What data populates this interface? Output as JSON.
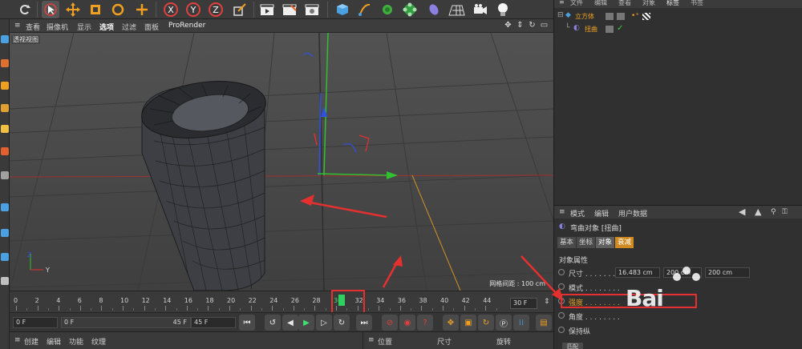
{
  "toolbar": {
    "icons": [
      "undo-icon",
      "select-icon",
      "move-icon",
      "scale-icon",
      "rotate-icon",
      "add-icon",
      "x-axis-icon",
      "y-axis-icon",
      "z-axis-icon",
      "world-coord-icon",
      "render-view-icon",
      "render-icon",
      "render-settings-icon",
      "cube-icon",
      "pen-icon",
      "nurbs-icon",
      "array-icon",
      "deformer-icon",
      "floor-icon",
      "camera-icon",
      "light-icon"
    ],
    "axis_x": "X",
    "axis_y": "Y",
    "axis_z": "Z"
  },
  "viewport": {
    "menus": [
      "查看",
      "摄像机",
      "显示",
      "选项",
      "过滤",
      "面板",
      "ProRender"
    ],
    "active_menu": "选项",
    "label": "透视视图",
    "grid_spacing": "网格间距 : 100 cm",
    "axis_y_label": "Y",
    "axis_z_label": "Z"
  },
  "timeline": {
    "ticks": [
      "0",
      "2",
      "4",
      "6",
      "8",
      "10",
      "12",
      "14",
      "16",
      "18",
      "20",
      "22",
      "24",
      "26",
      "28",
      "30",
      "32",
      "34",
      "36",
      "38",
      "40",
      "42",
      "44"
    ],
    "current_frame": "30",
    "frame_field": "30 F"
  },
  "playback": {
    "start_field": "0 F",
    "range_start": "0 F",
    "range_end": "45 F",
    "end_field": "45 F"
  },
  "bottom_left_menus": [
    "创建",
    "编辑",
    "功能",
    "纹理"
  ],
  "bottom_right_menus": [
    "位置",
    "尺寸",
    "旋转"
  ],
  "object_manager": {
    "menus": [
      "文件",
      "编辑",
      "查看",
      "对象",
      "标签",
      "书签"
    ],
    "active_menu": "标签",
    "objects": [
      {
        "name": "立方体"
      },
      {
        "name": "扭曲"
      }
    ]
  },
  "attribute_manager": {
    "menus": [
      "模式",
      "编辑",
      "用户数据"
    ],
    "title": "弯曲对象 [扭曲]",
    "tabs": [
      "基本",
      "坐标",
      "对象",
      "衰减"
    ],
    "active_tab": "对象",
    "section": "对象属性",
    "props": [
      {
        "label": "尺寸 . . . . . . . .",
        "v1": "16.483 cm",
        "v2": "200 cm",
        "v3": "200 cm"
      },
      {
        "label": "模式 . . . . . . . ."
      },
      {
        "label": "强度 . . . . . . . ."
      },
      {
        "label": "角度 . . . . . . . ."
      },
      {
        "label": "保持纵"
      }
    ],
    "bottom_button": "匹配"
  },
  "watermark": {
    "text": "Bai"
  },
  "colors": {
    "accent_orange": "#f0a020",
    "highlight_red": "#e53030",
    "axis_red": "#e03030",
    "axis_green": "#30c030",
    "axis_blue": "#3050e0"
  }
}
